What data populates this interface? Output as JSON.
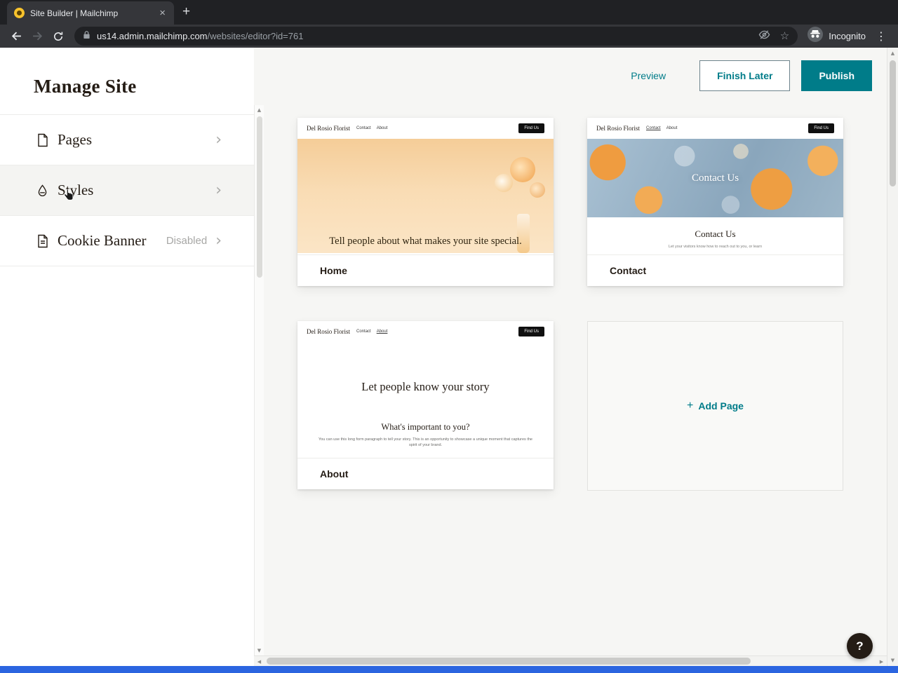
{
  "browser": {
    "tab_title": "Site Builder | Mailchimp",
    "url_host": "us14.admin.mailchimp.com",
    "url_path": "/websites/editor?id=761",
    "incognito_label": "Incognito",
    "close_glyph": "×",
    "newtab_glyph": "+",
    "star_glyph": "☆",
    "kebab_glyph": "⋮"
  },
  "sidebar": {
    "title": "Manage Site",
    "items": [
      {
        "label": "Pages",
        "meta": "",
        "chevron": "›"
      },
      {
        "label": "Styles",
        "meta": "",
        "chevron": "›"
      },
      {
        "label": "Cookie Banner",
        "meta": "Disabled",
        "chevron": "›"
      }
    ]
  },
  "actions": {
    "preview": "Preview",
    "finish_later": "Finish Later",
    "publish": "Publish"
  },
  "preview_site": {
    "brand": "Del Rosio Florist",
    "nav": [
      "Contact",
      "About"
    ],
    "cta": "Find Us"
  },
  "cards": {
    "home": {
      "label": "Home",
      "hero_text": "Tell people about what makes your site special."
    },
    "contact": {
      "label": "Contact",
      "hero_title": "Contact Us",
      "section_title": "Contact Us",
      "section_subtitle": "Let your visitors know how to reach out to you, or learn"
    },
    "about": {
      "label": "About",
      "hero_title": "Let people know your story",
      "section_title": "What's important to you?",
      "section_body": "You can use this long form paragraph to tell your story. This is an opportunity to showcase a unique moment that captures the spirit of your brand."
    },
    "add_page": {
      "label": "Add Page",
      "plus": "+"
    }
  },
  "help": {
    "label": "?"
  },
  "scrollbars": {
    "up": "▲",
    "down": "▼",
    "left": "◀",
    "right": "▶"
  },
  "colors": {
    "accent": "#007c89",
    "brand_text": "#241c15",
    "publish_bg": "#007c89"
  }
}
